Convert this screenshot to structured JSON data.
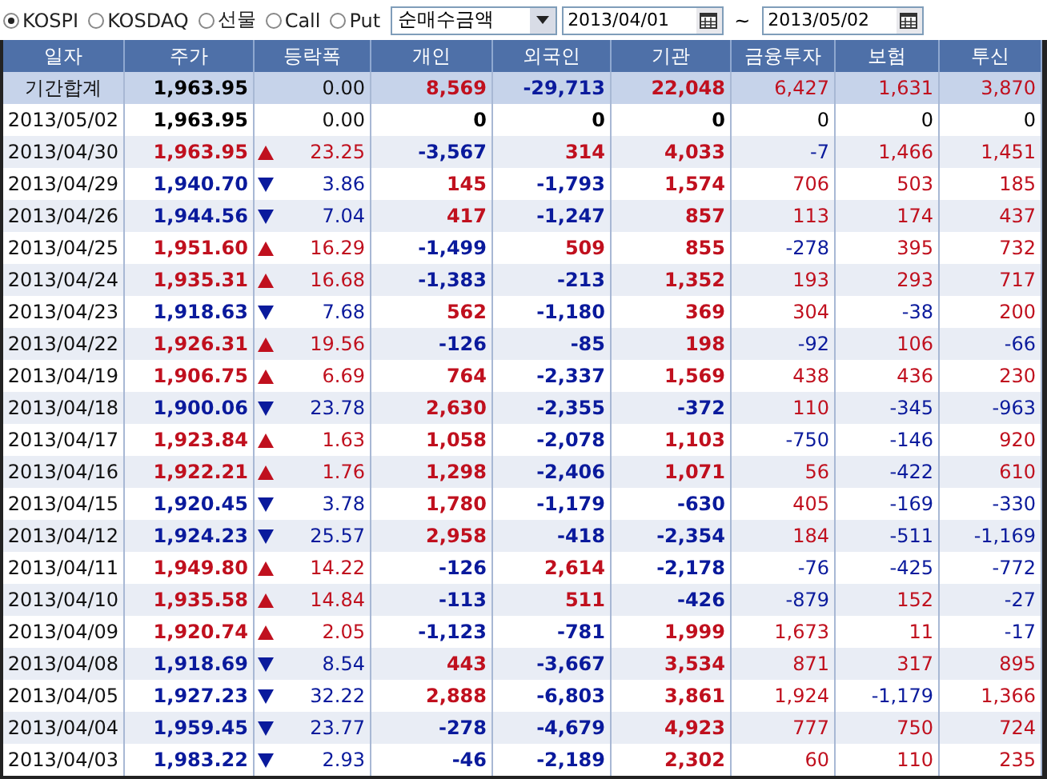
{
  "market_options": [
    {
      "label": "KOSPI",
      "selected": true
    },
    {
      "label": "KOSDAQ",
      "selected": false
    },
    {
      "label": "선물",
      "selected": false
    },
    {
      "label": "Call",
      "selected": false
    },
    {
      "label": "Put",
      "selected": false
    }
  ],
  "metric_select": {
    "value": "순매수금액"
  },
  "date_from": {
    "value": "2013/04/01"
  },
  "range_separator": "~",
  "date_to": {
    "value": "2013/05/02"
  },
  "table": {
    "columns": [
      "일자",
      "주가",
      "등락폭",
      "개인",
      "외국인",
      "기관",
      "금융투자",
      "보험",
      "투신"
    ],
    "rows": [
      {
        "kind": "total",
        "date": "기간합계",
        "price": "1,963.95",
        "rising": false,
        "falling": false,
        "change": "0.00",
        "values": [
          "8,569",
          "-29,713",
          "22,048",
          "6,427",
          "1,631",
          "3,870"
        ]
      },
      {
        "kind": "day",
        "date": "2013/05/02",
        "price": "1,963.95",
        "rising": false,
        "falling": false,
        "change": "0.00",
        "values": [
          "0",
          "0",
          "0",
          "0",
          "0",
          "0"
        ]
      },
      {
        "kind": "day",
        "date": "2013/04/30",
        "price": "1,963.95",
        "rising": true,
        "falling": false,
        "change": "23.25",
        "values": [
          "-3,567",
          "314",
          "4,033",
          "-7",
          "1,466",
          "1,451"
        ]
      },
      {
        "kind": "day",
        "date": "2013/04/29",
        "price": "1,940.70",
        "rising": false,
        "falling": true,
        "change": "3.86",
        "values": [
          "145",
          "-1,793",
          "1,574",
          "706",
          "503",
          "185"
        ]
      },
      {
        "kind": "day",
        "date": "2013/04/26",
        "price": "1,944.56",
        "rising": false,
        "falling": true,
        "change": "7.04",
        "values": [
          "417",
          "-1,247",
          "857",
          "113",
          "174",
          "437"
        ]
      },
      {
        "kind": "day",
        "date": "2013/04/25",
        "price": "1,951.60",
        "rising": true,
        "falling": false,
        "change": "16.29",
        "values": [
          "-1,499",
          "509",
          "855",
          "-278",
          "395",
          "732"
        ]
      },
      {
        "kind": "day",
        "date": "2013/04/24",
        "price": "1,935.31",
        "rising": true,
        "falling": false,
        "change": "16.68",
        "values": [
          "-1,383",
          "-213",
          "1,352",
          "193",
          "293",
          "717"
        ]
      },
      {
        "kind": "day",
        "date": "2013/04/23",
        "price": "1,918.63",
        "rising": false,
        "falling": true,
        "change": "7.68",
        "values": [
          "562",
          "-1,180",
          "369",
          "304",
          "-38",
          "200"
        ]
      },
      {
        "kind": "day",
        "date": "2013/04/22",
        "price": "1,926.31",
        "rising": true,
        "falling": false,
        "change": "19.56",
        "values": [
          "-126",
          "-85",
          "198",
          "-92",
          "106",
          "-66"
        ]
      },
      {
        "kind": "day",
        "date": "2013/04/19",
        "price": "1,906.75",
        "rising": true,
        "falling": false,
        "change": "6.69",
        "values": [
          "764",
          "-2,337",
          "1,569",
          "438",
          "436",
          "230"
        ]
      },
      {
        "kind": "day",
        "date": "2013/04/18",
        "price": "1,900.06",
        "rising": false,
        "falling": true,
        "change": "23.78",
        "values": [
          "2,630",
          "-2,355",
          "-372",
          "110",
          "-345",
          "-963"
        ]
      },
      {
        "kind": "day",
        "date": "2013/04/17",
        "price": "1,923.84",
        "rising": true,
        "falling": false,
        "change": "1.63",
        "values": [
          "1,058",
          "-2,078",
          "1,103",
          "-750",
          "-146",
          "920"
        ]
      },
      {
        "kind": "day",
        "date": "2013/04/16",
        "price": "1,922.21",
        "rising": true,
        "falling": false,
        "change": "1.76",
        "values": [
          "1,298",
          "-2,406",
          "1,071",
          "56",
          "-422",
          "610"
        ]
      },
      {
        "kind": "day",
        "date": "2013/04/15",
        "price": "1,920.45",
        "rising": false,
        "falling": true,
        "change": "3.78",
        "values": [
          "1,780",
          "-1,179",
          "-630",
          "405",
          "-169",
          "-330"
        ]
      },
      {
        "kind": "day",
        "date": "2013/04/12",
        "price": "1,924.23",
        "rising": false,
        "falling": true,
        "change": "25.57",
        "values": [
          "2,958",
          "-418",
          "-2,354",
          "184",
          "-511",
          "-1,169"
        ]
      },
      {
        "kind": "day",
        "date": "2013/04/11",
        "price": "1,949.80",
        "rising": true,
        "falling": false,
        "change": "14.22",
        "values": [
          "-126",
          "2,614",
          "-2,178",
          "-76",
          "-425",
          "-772"
        ]
      },
      {
        "kind": "day",
        "date": "2013/04/10",
        "price": "1,935.58",
        "rising": true,
        "falling": false,
        "change": "14.84",
        "values": [
          "-113",
          "511",
          "-426",
          "-879",
          "152",
          "-27"
        ]
      },
      {
        "kind": "day",
        "date": "2013/04/09",
        "price": "1,920.74",
        "rising": true,
        "falling": false,
        "change": "2.05",
        "values": [
          "-1,123",
          "-781",
          "1,999",
          "1,673",
          "11",
          "-17"
        ]
      },
      {
        "kind": "day",
        "date": "2013/04/08",
        "price": "1,918.69",
        "rising": false,
        "falling": true,
        "change": "8.54",
        "values": [
          "443",
          "-3,667",
          "3,534",
          "871",
          "317",
          "895"
        ]
      },
      {
        "kind": "day",
        "date": "2013/04/05",
        "price": "1,927.23",
        "rising": false,
        "falling": true,
        "change": "32.22",
        "values": [
          "2,888",
          "-6,803",
          "3,861",
          "1,924",
          "-1,179",
          "1,366"
        ]
      },
      {
        "kind": "day",
        "date": "2013/04/04",
        "price": "1,959.45",
        "rising": false,
        "falling": true,
        "change": "23.77",
        "values": [
          "-278",
          "-4,679",
          "4,923",
          "777",
          "750",
          "724"
        ]
      },
      {
        "kind": "day",
        "date": "2013/04/03",
        "price": "1,983.22",
        "rising": false,
        "falling": true,
        "change": "2.93",
        "values": [
          "-46",
          "-2,189",
          "2,302",
          "60",
          "110",
          "235"
        ]
      }
    ]
  }
}
